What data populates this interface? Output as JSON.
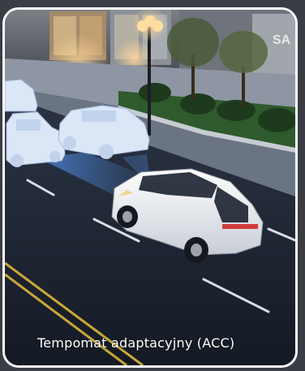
{
  "caption": {
    "label": "Tempomat adaptacyjny (ACC)"
  },
  "scene": {
    "store_sign_fragment": "SA"
  },
  "colors": {
    "frame_border": "#ffffff",
    "page_background": "#3a3d44",
    "road": "#1d2533",
    "lane_marking": "#d9dde8",
    "center_line": "#c9a83a",
    "sensor_beam": "#3b7bd6",
    "ghost_car": "#d7e4f7",
    "hero_car": "#eef1f5",
    "grass": "#2d5a2a",
    "sidewalk": "#7a8595"
  }
}
